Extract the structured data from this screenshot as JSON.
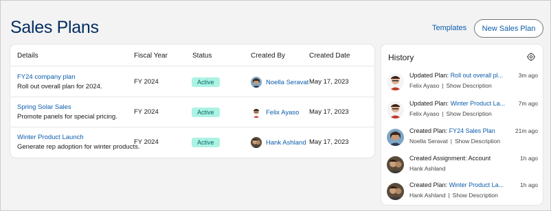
{
  "header": {
    "title": "Sales Plans",
    "templates_label": "Templates",
    "new_plan_label": "New Sales Plan"
  },
  "table": {
    "columns": [
      "Details",
      "Fiscal Year",
      "Status",
      "Created By",
      "Created Date"
    ],
    "rows": [
      {
        "name": "FY24 company plan",
        "description": "Roll out overall plan for 2024.",
        "fiscal_year": "FY 2024",
        "status": "Active",
        "created_by": "Noella Seravat",
        "created_date": "May 17, 2023"
      },
      {
        "name": "Spring Solar Sales",
        "description": "Promote panels for special pricing.",
        "fiscal_year": "FY 2024",
        "status": "Active",
        "created_by": "Felix Ayaso",
        "created_date": "May 17, 2023"
      },
      {
        "name": "Winter Product Launch",
        "description": "Generate rep adoption for winter products.",
        "fiscal_year": "FY 2024",
        "status": "Active",
        "created_by": "Hank Ashland",
        "created_date": "May 17, 2023"
      }
    ]
  },
  "history": {
    "title": "History",
    "items": [
      {
        "action": "Updated Plan:",
        "link": "Roll out overall pl...",
        "time": "3m ago",
        "user": "Felix Ayaso",
        "show": "Show Description"
      },
      {
        "action": "Updated Plan:",
        "link": "Winter Product La...",
        "time": "7m ago",
        "user": "Felix Ayaso",
        "show": "Show Description"
      },
      {
        "action": "Created Plan:",
        "link": "FY24 Sales Plan",
        "time": "21m ago",
        "user": "Noella Seravat",
        "show": "Show Description"
      },
      {
        "action": "Created Assignment: Account",
        "link": "",
        "time": "1h ago",
        "user": "Hank Ashland",
        "show": ""
      },
      {
        "action": "Created Plan:",
        "link": "Winter Product La...",
        "time": "1h ago",
        "user": "Hank Ashland",
        "show": "Show Description"
      }
    ]
  },
  "colors": {
    "brand_title": "#032d60",
    "link": "#0b5cab",
    "badge_bg": "#acf3e4",
    "badge_text": "#056764"
  }
}
